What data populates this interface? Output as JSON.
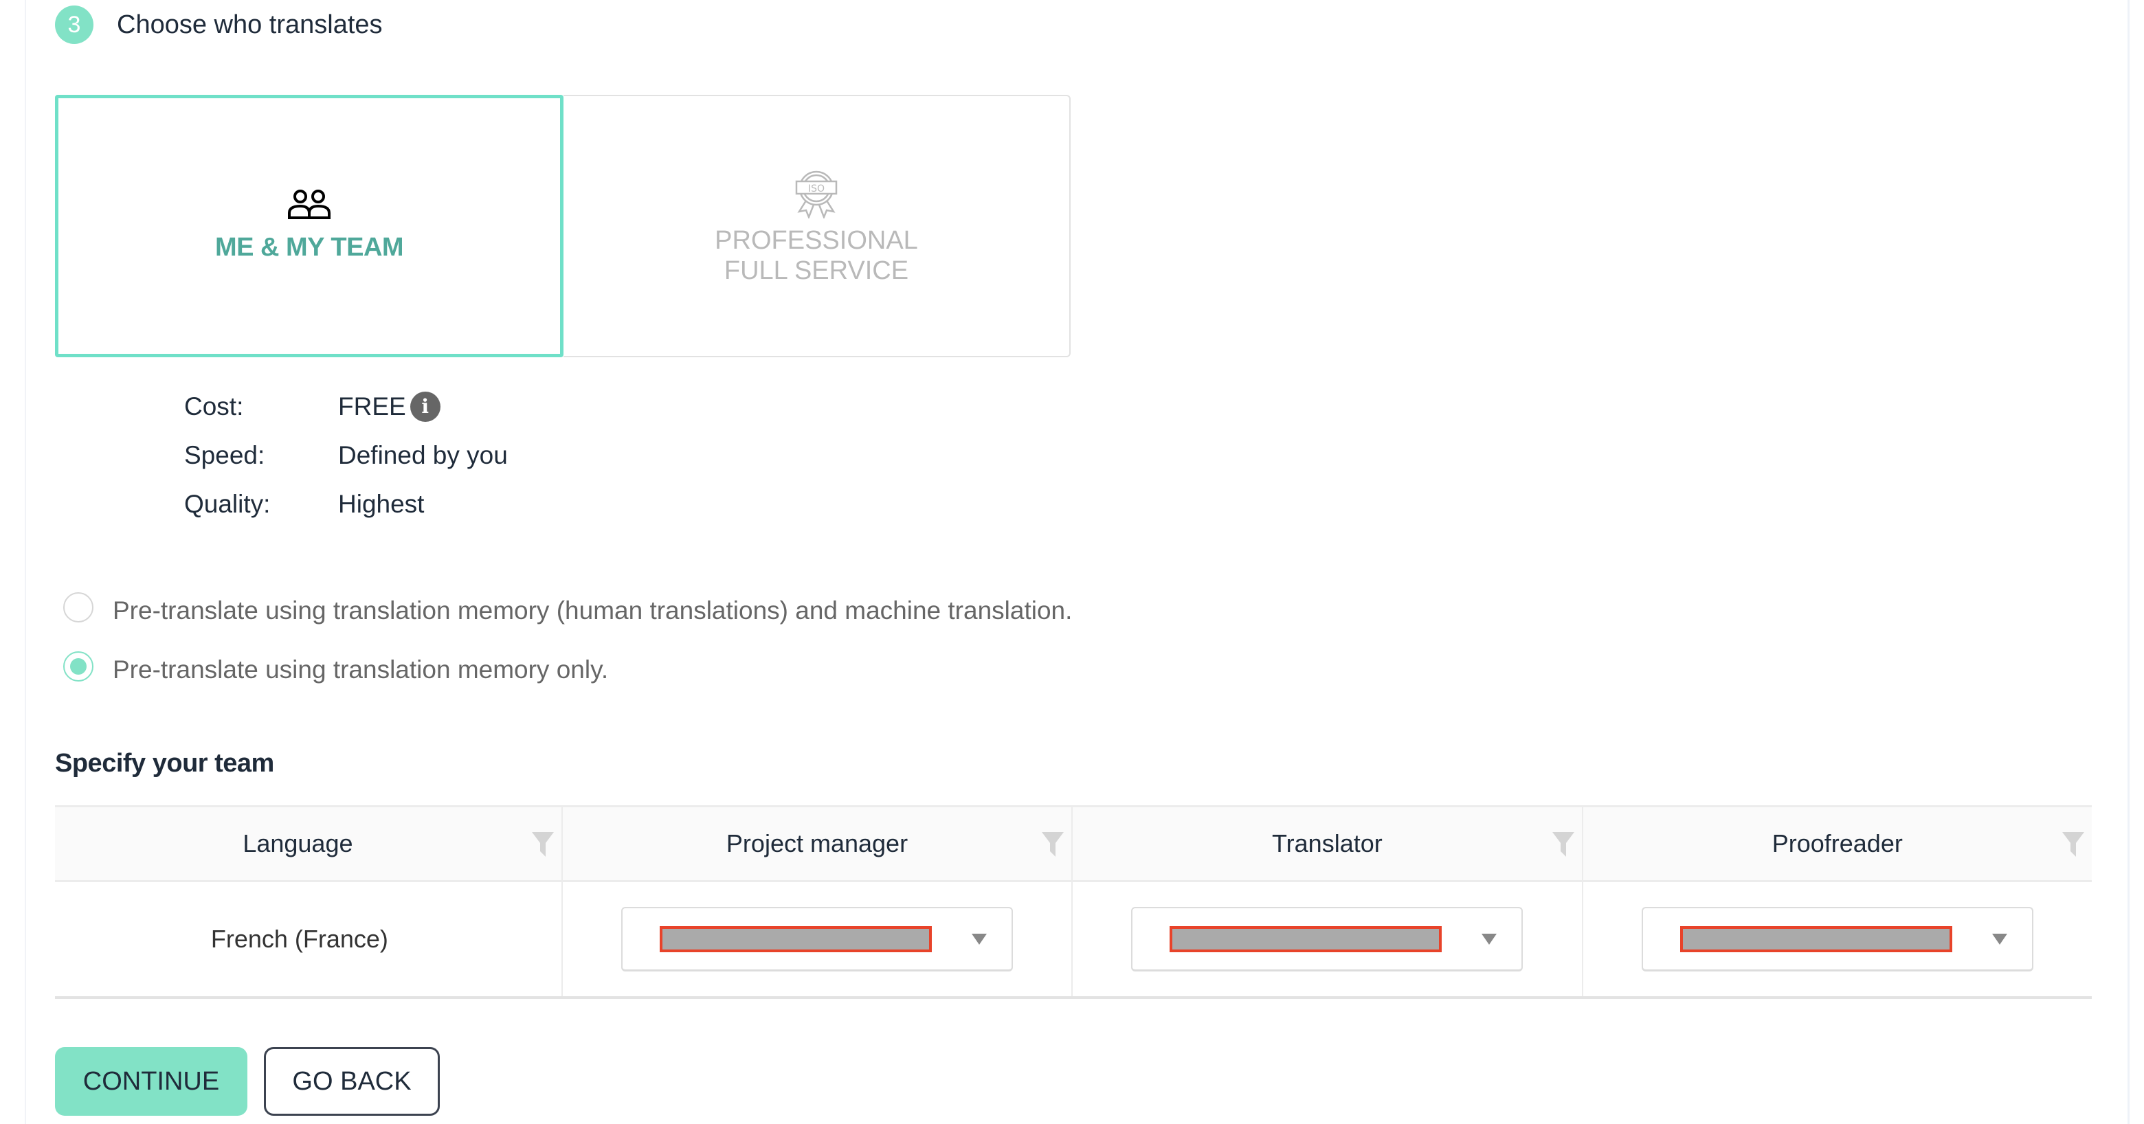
{
  "step": {
    "number": "3",
    "title": "Choose who translates"
  },
  "options": [
    {
      "label": "ME & MY TEAM",
      "icon": "team-icon",
      "selected": true
    },
    {
      "label_line1": "PROFESSIONAL",
      "label_line2": "FULL SERVICE",
      "icon": "iso-badge-icon",
      "selected": false
    }
  ],
  "specs": [
    {
      "label": "Cost:",
      "value": "FREE",
      "info_icon": "i"
    },
    {
      "label": "Speed:",
      "value": "Defined by you"
    },
    {
      "label": "Quality:",
      "value": "Highest"
    }
  ],
  "pretranslate": {
    "options": [
      {
        "label": "Pre-translate using translation memory (human translations) and machine translation.",
        "checked": false
      },
      {
        "label": "Pre-translate using translation memory only.",
        "checked": true
      }
    ]
  },
  "team": {
    "title": "Specify your team",
    "columns": [
      "Language",
      "Project manager",
      "Translator",
      "Proofreader"
    ],
    "rows": [
      {
        "language": "French (France)",
        "project_manager": "[redacted]",
        "translator": "[redacted]",
        "proofreader": "[redacted]"
      }
    ]
  },
  "colors": {
    "accent": "#82e2c6",
    "selected_border": "#6fe0c8",
    "selected_text": "#4fa89a",
    "redaction_border": "#e8432a"
  },
  "buttons": {
    "continue": "CONTINUE",
    "go_back": "GO BACK"
  }
}
